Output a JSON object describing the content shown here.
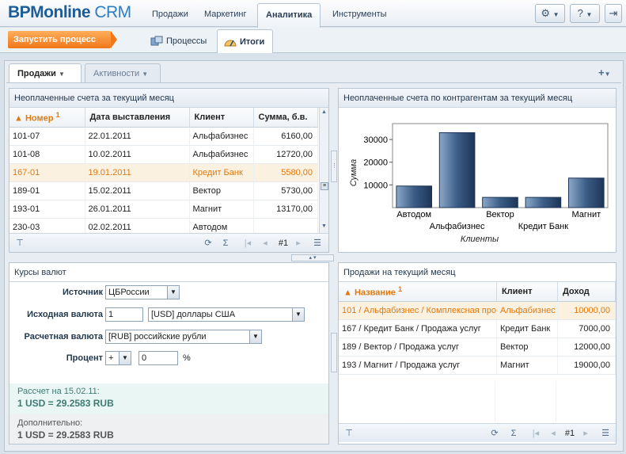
{
  "app": {
    "logo_main": "BPMonline",
    "logo_crm": " CRM"
  },
  "nav": {
    "items": [
      "Продажи",
      "Маркетинг",
      "Аналитика",
      "Инструменты"
    ]
  },
  "actions": {
    "run_process": "Запустить процесс"
  },
  "subtabs": {
    "processes": "Процессы",
    "results": "Итоги"
  },
  "tabs": {
    "sales": "Продажи",
    "activities": "Активности"
  },
  "unpaid": {
    "title": "Неоплаченные счета за текущий месяц",
    "columns": [
      "Номер",
      "Дата выставления",
      "Клиент",
      "Сумма, б.в."
    ],
    "sort_mark": "1",
    "rows": [
      [
        "101-07",
        "22.01.2011",
        "Альфабизнес",
        "6160,00"
      ],
      [
        "101-08",
        "10.02.2011",
        "Альфабизнес",
        "12720,00"
      ],
      [
        "167-01",
        "19.01.2011",
        "Кредит Банк",
        "5580,00"
      ],
      [
        "189-01",
        "15.02.2011",
        "Вектор",
        "5730,00"
      ],
      [
        "193-01",
        "26.01.2011",
        "Магнит",
        "13170,00"
      ],
      [
        "230-03",
        "02.02.2011",
        "Автодом",
        ""
      ]
    ],
    "page": "#1"
  },
  "chart": {
    "title": "Неоплаченные счета по контрагентам за текущий месяц"
  },
  "chart_data": {
    "type": "bar",
    "categories": [
      "Автодом",
      "Альфабизнес",
      "Вектор",
      "Кредит Банк",
      "Магнит"
    ],
    "values": [
      9500,
      33000,
      4500,
      4500,
      13000
    ],
    "ylim": [
      0,
      37000
    ],
    "yticks": [
      "10000",
      "20000",
      "30000"
    ],
    "xlabel": "Клиенты",
    "ylabel": "Сумма"
  },
  "currency": {
    "title": "Курсы валют",
    "source_label": "Источник",
    "source_value": "ЦБРоссии",
    "from_label": "Исходная валюта",
    "from_amount": "1",
    "from_currency": "[USD] доллары США",
    "to_label": "Расчетная валюта",
    "to_currency": "[RUB] российские рубли",
    "percent_label": "Процент",
    "percent_sign": "+",
    "percent_value": "0",
    "percent_unit": "%",
    "calc_date": "Рассчет на 15.02.11:",
    "calc_rate": "1 USD = 29.2583 RUB",
    "extra_label": "Дополнительно:",
    "extra_rate": "1 USD = 29.2583 RUB"
  },
  "sales": {
    "title": "Продажи на текущий месяц",
    "columns": [
      "Название",
      "Клиент",
      "Доход"
    ],
    "sort_mark": "1",
    "rows": [
      [
        "101 / Альфабизнес / Комплексная про",
        "Альфабизнес",
        "10000,00"
      ],
      [
        "167 / Кредит Банк / Продажа услуг",
        "Кредит Банк",
        "7000,00"
      ],
      [
        "189 / Вектор / Продажа услуг",
        "Вектор",
        "12000,00"
      ],
      [
        "193 / Магнит / Продажа услуг",
        "Магнит",
        "19000,00"
      ]
    ],
    "page": "#1"
  },
  "colors": {
    "accent": "#f0771a",
    "brand": "#1d5e9a",
    "selected_row": "#e07a10"
  }
}
